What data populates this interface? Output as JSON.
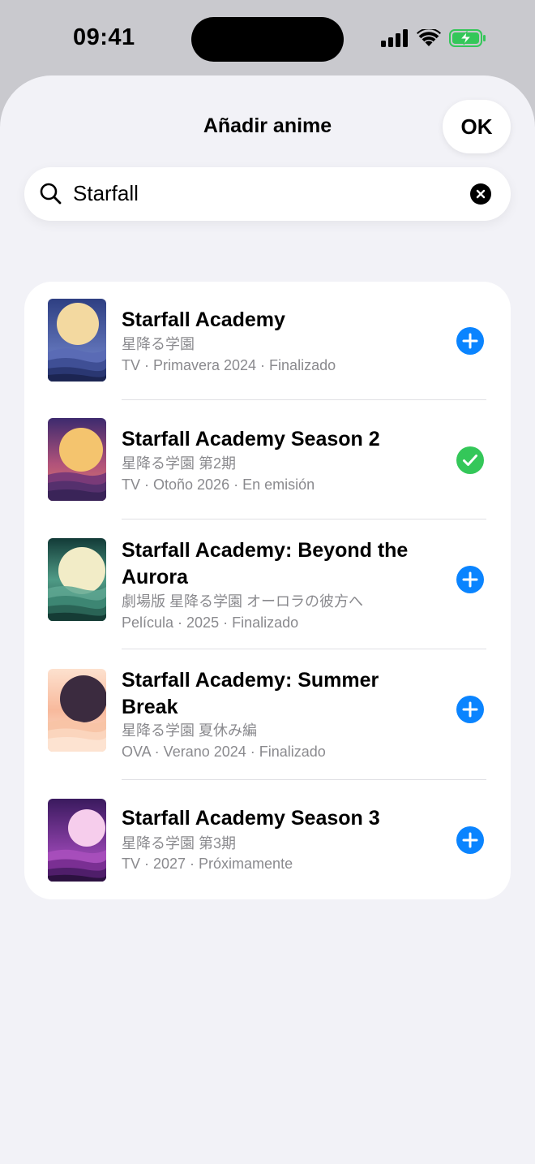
{
  "status": {
    "time": "09:41"
  },
  "sheet": {
    "title": "Añadir anime",
    "ok_label": "OK"
  },
  "search": {
    "value": "Starfall"
  },
  "results": [
    {
      "title": "Starfall Academy",
      "japanese": "星降る学園",
      "meta": "TV · Primavera 2024 · Finalizado",
      "action": "add"
    },
    {
      "title": "Starfall Academy Season 2",
      "japanese": "星降る学園 第2期",
      "meta": "TV · Otoño 2026 · En emisión",
      "action": "added"
    },
    {
      "title": "Starfall Academy: Beyond the Aurora",
      "japanese": "劇場版 星降る学園 オーロラの彼方へ",
      "meta": "Película · 2025 · Finalizado",
      "action": "add"
    },
    {
      "title": "Starfall Academy: Summer Break",
      "japanese": "星降る学園 夏休み編",
      "meta": "OVA · Verano 2024 · Finalizado",
      "action": "add"
    },
    {
      "title": "Starfall Academy Season 3",
      "japanese": "星降る学園 第3期",
      "meta": "TV · 2027 · Próximamente",
      "action": "add"
    }
  ],
  "colors": {
    "accent": "#0a84ff",
    "success": "#34c759",
    "battery": "#34c759"
  },
  "icons": [
    "search-icon",
    "clear-icon",
    "add-icon",
    "checkmark-icon",
    "signal-icon",
    "wifi-icon",
    "battery-icon"
  ]
}
